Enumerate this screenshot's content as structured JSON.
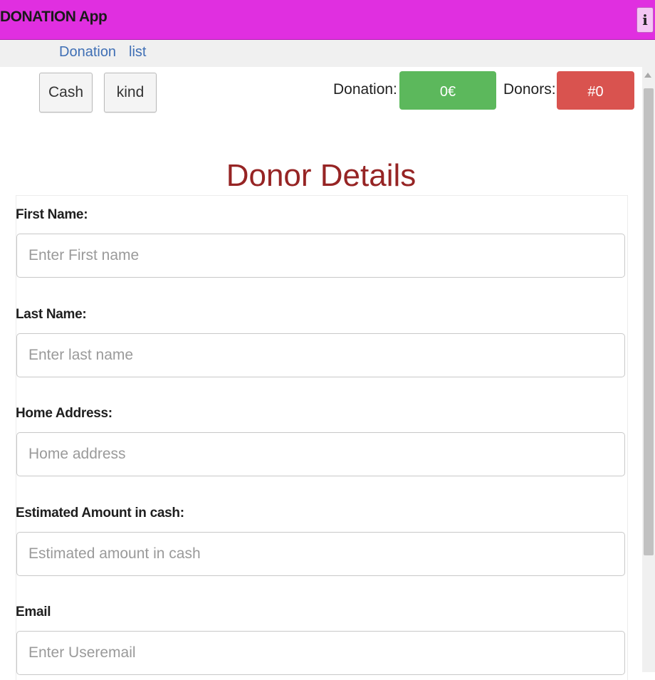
{
  "app": {
    "title": "DONATION App",
    "info_icon": "i"
  },
  "nav": {
    "items": [
      {
        "label": "Donation"
      },
      {
        "label": "list"
      }
    ]
  },
  "toolbar": {
    "cash_label": "Cash",
    "kind_label": "kind"
  },
  "stats": {
    "donation_label": "Donation:",
    "donation_value": "0€",
    "donation_color": "#5cb85c",
    "donors_label": "Donors:",
    "donors_value": "#0",
    "donors_color": "#d9534f"
  },
  "form": {
    "heading": "Donor Details",
    "fields": [
      {
        "label": "First Name:",
        "placeholder": "Enter First name",
        "value": ""
      },
      {
        "label": "Last Name:",
        "placeholder": "Enter last name",
        "value": ""
      },
      {
        "label": "Home Address:",
        "placeholder": "Home address",
        "value": ""
      },
      {
        "label": "Estimated Amount in cash:",
        "placeholder": "Estimated amount in cash",
        "value": ""
      },
      {
        "label": "Email",
        "placeholder": "Enter Useremail",
        "value": ""
      }
    ]
  },
  "colors": {
    "titlebar": "#e02fe0",
    "heading": "#962424",
    "nav_link": "#3f6fb5"
  }
}
